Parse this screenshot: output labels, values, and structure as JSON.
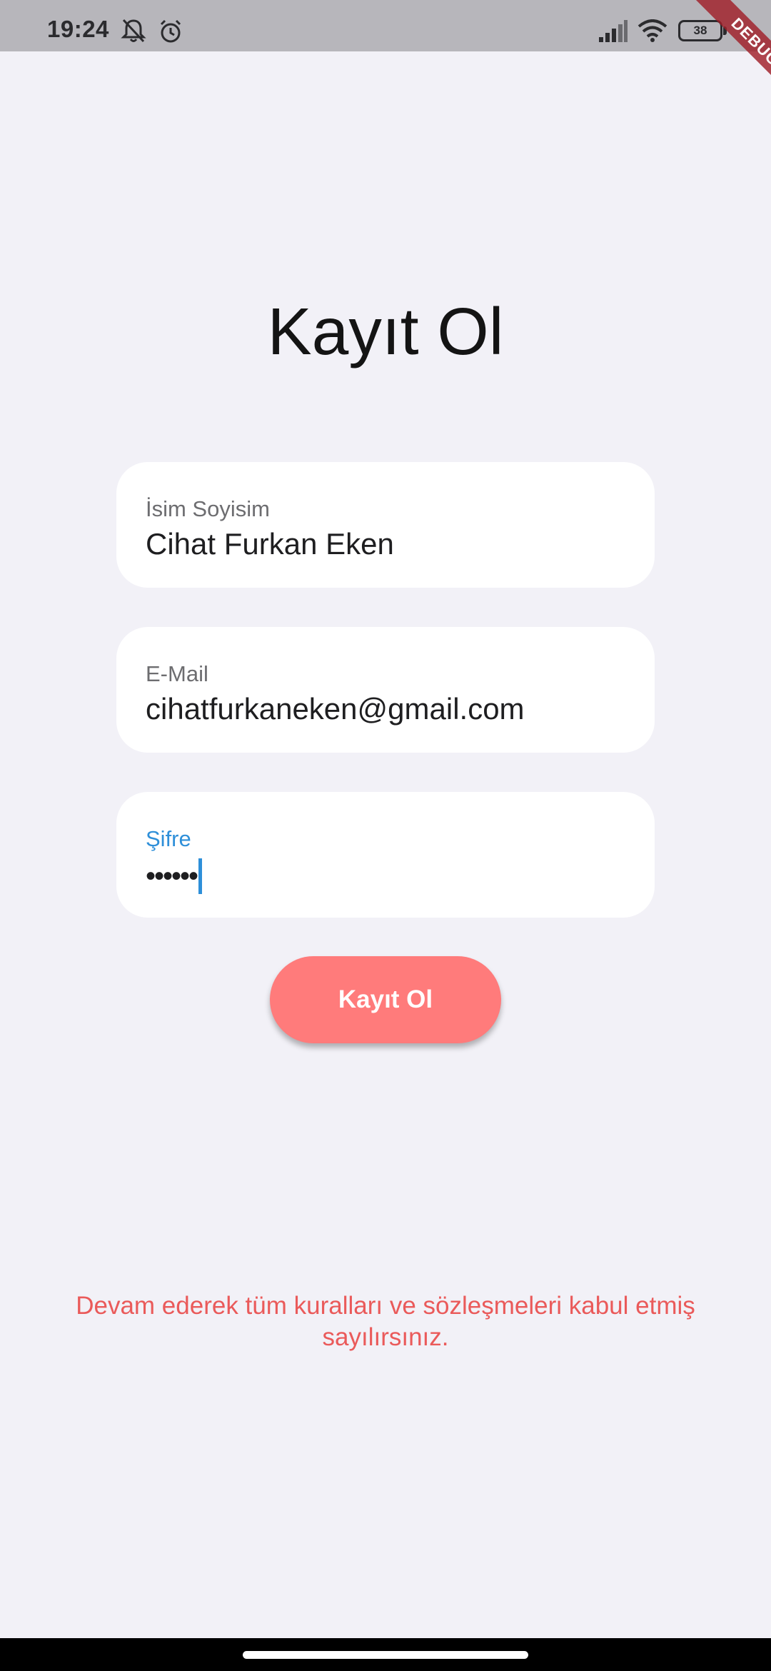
{
  "status_bar": {
    "time": "19:24",
    "battery_level": "38",
    "icons": [
      "notifications-off-icon",
      "alarm-icon",
      "signal-icon",
      "wifi-icon",
      "battery-icon"
    ],
    "debug_banner": "DEBUG"
  },
  "page": {
    "title": "Kayıt Ol"
  },
  "form": {
    "name": {
      "label": "İsim Soyisim",
      "value": "Cihat Furkan Eken"
    },
    "email": {
      "label": "E-Mail",
      "value": "cihatfurkaneken@gmail.com"
    },
    "password": {
      "label": "Şifre",
      "masked_value": "••••••",
      "focused": true
    },
    "submit_label": "Kayıt Ol"
  },
  "footer": {
    "terms": "Devam ederek tüm kuralları ve sözleşmeleri kabul etmiş sayılırsınız."
  },
  "colors": {
    "background": "#f2f1f7",
    "field_background": "#ffffff",
    "accent_button": "#ff7b7b",
    "focus_blue": "#2e8fd9",
    "terms_red": "#ea5a5a"
  }
}
